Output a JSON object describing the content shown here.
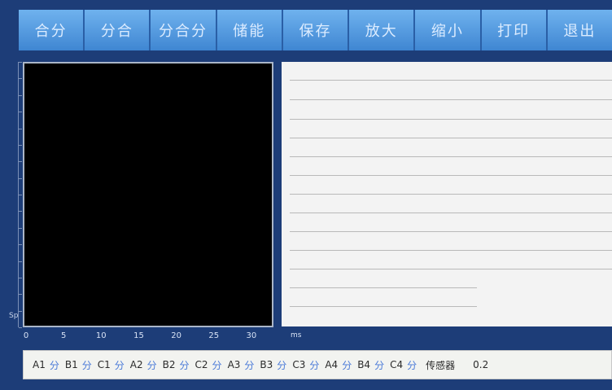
{
  "toolbar": {
    "buttons": [
      "合分",
      "分合",
      "分合分",
      "储能",
      "保存",
      "放大",
      "缩小",
      "打印",
      "退出"
    ]
  },
  "plot": {
    "y_axis_label": "Sp",
    "x_ticks": [
      "0",
      "5",
      "10",
      "15",
      "20",
      "25",
      "30"
    ],
    "x_unit": "ms"
  },
  "status": {
    "channels": [
      {
        "name": "A1",
        "value": "分"
      },
      {
        "name": "B1",
        "value": "分"
      },
      {
        "name": "C1",
        "value": "分"
      },
      {
        "name": "A2",
        "value": "分"
      },
      {
        "name": "B2",
        "value": "分"
      },
      {
        "name": "C2",
        "value": "分"
      },
      {
        "name": "A3",
        "value": "分"
      },
      {
        "name": "B3",
        "value": "分"
      },
      {
        "name": "C3",
        "value": "分"
      },
      {
        "name": "A4",
        "value": "分"
      },
      {
        "name": "B4",
        "value": "分"
      },
      {
        "name": "C4",
        "value": "分"
      }
    ],
    "sensor_label": "传感器",
    "sensor_value": "0.2"
  },
  "colors": {
    "background": "#1d3d78",
    "toolbar": "#4a8fd6",
    "status_value": "#4a7ad8"
  }
}
